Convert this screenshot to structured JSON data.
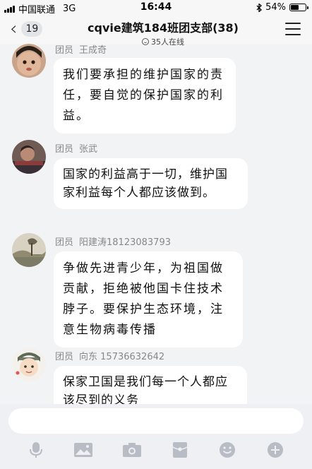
{
  "status": {
    "carrier": "中国联通",
    "network": "3G",
    "time": "16:44",
    "battery": "54%",
    "battery_level": 0.54
  },
  "nav": {
    "back_count": "19",
    "title": "cqvie建筑184班团支部(38)",
    "subtitle": "35人在线"
  },
  "messages": [
    {
      "role": "团员",
      "name": "王成奇",
      "text": "我们要承担的维护国家的责任，要自觉的保护国家的利益。"
    },
    {
      "role": "团员",
      "name": "张武",
      "text": "国家的利益高于一切，维护国家利益每个人都应该做到。"
    },
    {
      "role": "团员",
      "name": "阳建涛18123083793",
      "text": "争做先进青少年，为祖国做贡献，拒绝被他国卡住技术脖子。要保护生态环境，注意生物病毒传播"
    },
    {
      "role": "团员",
      "name": "向东  15736632642",
      "text": "保家卫国是我们每一个人都应该尽到的义务"
    }
  ],
  "input": {
    "value": "",
    "placeholder": ""
  },
  "toolbar_icons": [
    "microphone-icon",
    "image-icon",
    "camera-icon",
    "red-packet-icon",
    "emoji-icon",
    "plus-icon"
  ],
  "colors": {
    "background": "#f2f3f5",
    "bubble": "#ffffff",
    "icon": "#b8bcc4"
  }
}
